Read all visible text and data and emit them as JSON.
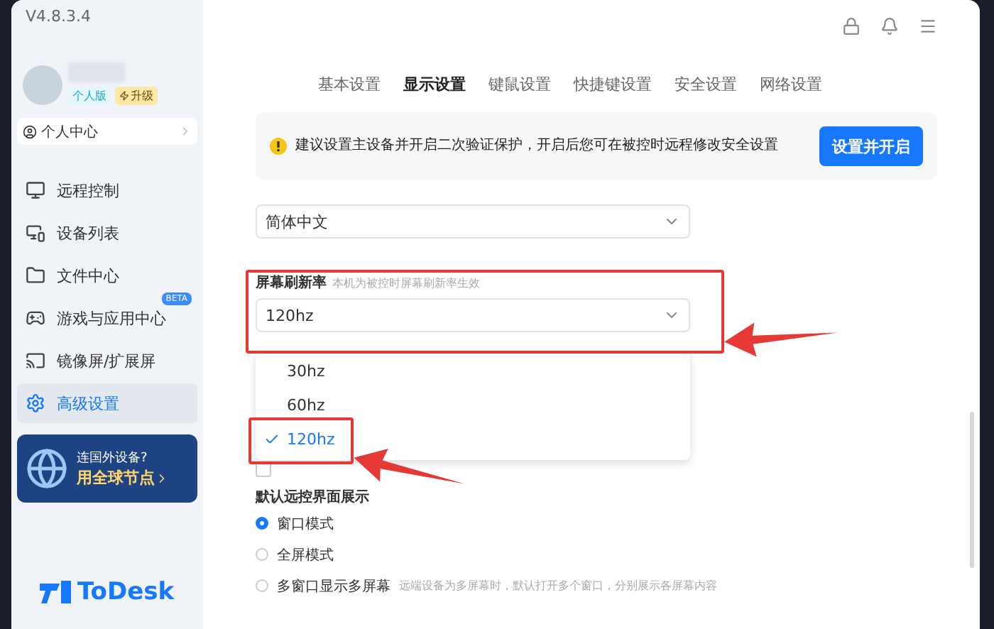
{
  "sidebar": {
    "version": "V4.8.3.4",
    "account": {
      "badges": [
        {
          "label": "个人版",
          "kind": "edition"
        },
        {
          "label": "升级",
          "kind": "upgrade"
        }
      ],
      "center_link": "个人中心"
    },
    "items": [
      {
        "label": "远程控制",
        "selected": false
      },
      {
        "label": "设备列表",
        "selected": false
      },
      {
        "label": "文件中心",
        "selected": false
      },
      {
        "label": "游戏与应用中心",
        "selected": false,
        "badge": "BETA"
      },
      {
        "label": "镜像屏/扩展屏",
        "selected": false
      },
      {
        "label": "高级设置",
        "selected": true
      }
    ],
    "promo": {
      "line1": "连国外设备?",
      "line2": "用全球节点"
    },
    "logo": "ToDesk"
  },
  "tabs": [
    {
      "label": "基本设置",
      "selected": false
    },
    {
      "label": "显示设置",
      "selected": true
    },
    {
      "label": "键鼠设置",
      "selected": false
    },
    {
      "label": "快捷键设置",
      "selected": false
    },
    {
      "label": "安全设置",
      "selected": false
    },
    {
      "label": "网络设置",
      "selected": false
    }
  ],
  "alert": {
    "text": "建议设置主设备并开启二次验证保护，开启后您可在被控时远程修改安全设置",
    "button": "设置并开启"
  },
  "language_select": {
    "value": "简体中文"
  },
  "refresh_rate": {
    "label": "屏幕刷新率",
    "hint": "本机为被控时屏幕刷新率生效",
    "value": "120hz",
    "expanded": true,
    "options": [
      {
        "label": "30hz",
        "selected": false
      },
      {
        "label": "60hz",
        "selected": false
      },
      {
        "label": "120hz",
        "selected": true
      }
    ]
  },
  "lock_checkbox": {
    "checked": false
  },
  "display_mode": {
    "title": "默认远控界面展示",
    "options": [
      {
        "label": "窗口模式",
        "selected": true
      },
      {
        "label": "全屏模式",
        "selected": false
      },
      {
        "label": "多窗口显示多屏幕",
        "hint": "远端设备为多屏幕时，默认打开多个窗口，分别展示各屏幕内容",
        "selected": false
      }
    ]
  }
}
